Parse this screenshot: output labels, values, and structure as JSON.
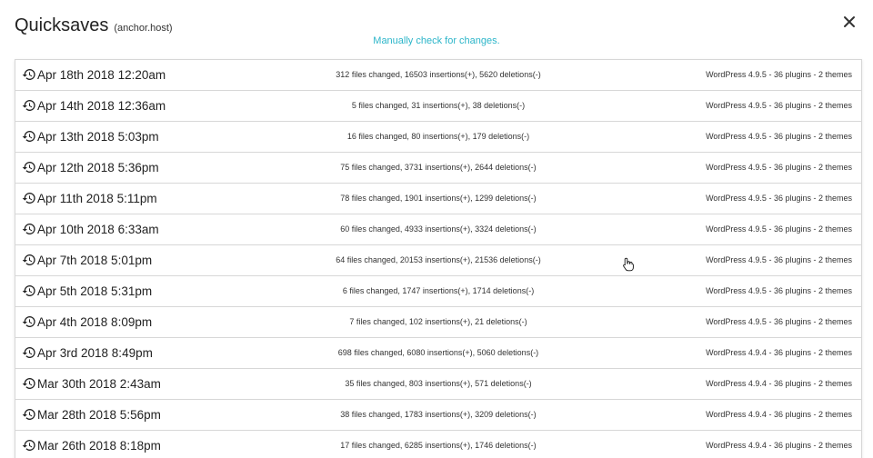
{
  "header": {
    "title": "Quicksaves",
    "subtitle": "(anchor.host)",
    "check_link": "Manually check for changes."
  },
  "icons": {
    "close": "close-icon",
    "row": "history-icon",
    "cursor": "hand-pointer-icon"
  },
  "colors": {
    "accent": "#2bb5c9",
    "border": "#d7d7d7"
  },
  "quicksaves": [
    {
      "date": "Apr 18th 2018 12:20am",
      "changes": "312 files changed, 16503 insertions(+), 5620 deletions(-)",
      "env": "WordPress 4.9.5 - 36 plugins - 2 themes"
    },
    {
      "date": "Apr 14th 2018 12:36am",
      "changes": "5 files changed, 31 insertions(+), 38 deletions(-)",
      "env": "WordPress 4.9.5 - 36 plugins - 2 themes"
    },
    {
      "date": "Apr 13th 2018 5:03pm",
      "changes": "16 files changed, 80 insertions(+), 179 deletions(-)",
      "env": "WordPress 4.9.5 - 36 plugins - 2 themes"
    },
    {
      "date": "Apr 12th 2018 5:36pm",
      "changes": "75 files changed, 3731 insertions(+), 2644 deletions(-)",
      "env": "WordPress 4.9.5 - 36 plugins - 2 themes"
    },
    {
      "date": "Apr 11th 2018 5:11pm",
      "changes": "78 files changed, 1901 insertions(+), 1299 deletions(-)",
      "env": "WordPress 4.9.5 - 36 plugins - 2 themes"
    },
    {
      "date": "Apr 10th 2018 6:33am",
      "changes": "60 files changed, 4933 insertions(+), 3324 deletions(-)",
      "env": "WordPress 4.9.5 - 36 plugins - 2 themes"
    },
    {
      "date": "Apr 7th 2018 5:01pm",
      "changes": "64 files changed, 20153 insertions(+), 21536 deletions(-)",
      "env": "WordPress 4.9.5 - 36 plugins - 2 themes"
    },
    {
      "date": "Apr 5th 2018 5:31pm",
      "changes": "6 files changed, 1747 insertions(+), 1714 deletions(-)",
      "env": "WordPress 4.9.5 - 36 plugins - 2 themes"
    },
    {
      "date": "Apr 4th 2018 8:09pm",
      "changes": "7 files changed, 102 insertions(+), 21 deletions(-)",
      "env": "WordPress 4.9.5 - 36 plugins - 2 themes"
    },
    {
      "date": "Apr 3rd 2018 8:49pm",
      "changes": "698 files changed, 6080 insertions(+), 5060 deletions(-)",
      "env": "WordPress 4.9.4 - 36 plugins - 2 themes"
    },
    {
      "date": "Mar 30th 2018 2:43am",
      "changes": "35 files changed, 803 insertions(+), 571 deletions(-)",
      "env": "WordPress 4.9.4 - 36 plugins - 2 themes"
    },
    {
      "date": "Mar 28th 2018 5:56pm",
      "changes": "38 files changed, 1783 insertions(+), 3209 deletions(-)",
      "env": "WordPress 4.9.4 - 36 plugins - 2 themes"
    },
    {
      "date": "Mar 26th 2018 8:18pm",
      "changes": "17 files changed, 6285 insertions(+), 1746 deletions(-)",
      "env": "WordPress 4.9.4 - 36 plugins - 2 themes"
    }
  ]
}
